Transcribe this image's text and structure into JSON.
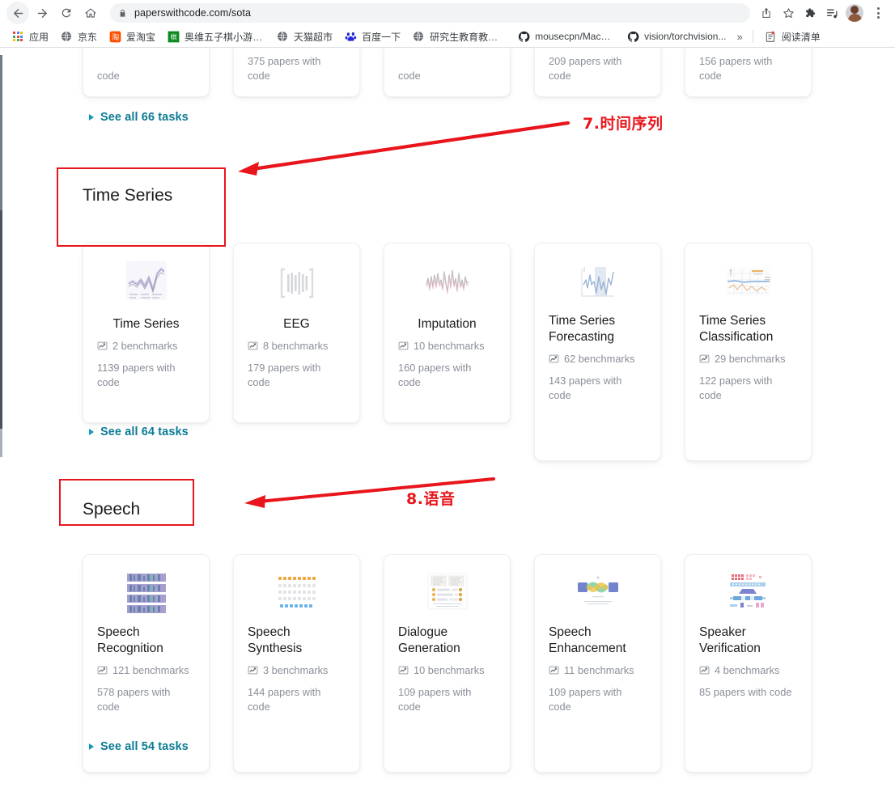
{
  "browser": {
    "url": "paperswithcode.com/sota",
    "nav": {
      "back": "back-arrow",
      "forward": "forward-arrow",
      "reload": "reload",
      "home": "home"
    },
    "toolbar_icons": [
      "share-icon",
      "star-icon",
      "extensions-icon",
      "reading-list-icon",
      "profile-avatar",
      "menu-kebab-icon"
    ],
    "bookmarks": [
      {
        "label": "应用",
        "icon": "apps-grid-icon"
      },
      {
        "label": "京东",
        "icon": "globe-icon"
      },
      {
        "label": "爱淘宝",
        "icon": "taobao-icon"
      },
      {
        "label": "奥维五子棋小游戏,...",
        "icon": "game-icon"
      },
      {
        "label": "天猫超市",
        "icon": "globe-icon"
      },
      {
        "label": "百度一下",
        "icon": "baidu-icon"
      },
      {
        "label": "研究生教育教学管...",
        "icon": "globe-icon"
      },
      {
        "label": "mousecpn/Machi...",
        "icon": "github-icon"
      },
      {
        "label": "vision/torchvision...",
        "icon": "github-icon"
      }
    ],
    "overflow_label": "»",
    "reading_list": {
      "label": "阅读清单",
      "icon": "reading-list-icon"
    }
  },
  "page": {
    "clipped_top_row": {
      "papers_labels": [
        "code",
        "375 papers with code",
        "code",
        "209 papers with code",
        "156 papers with code"
      ]
    },
    "see_all_top": "See all 66 tasks",
    "sections": [
      {
        "id": "time-series",
        "title": "Time Series",
        "see_all": "See all 64 tasks",
        "cards": [
          {
            "title": "Time Series",
            "benchmarks": "2 benchmarks",
            "papers": "1139 papers with code",
            "thumb": "line-chart-thumb",
            "center_title": true
          },
          {
            "title": "EEG",
            "benchmarks": "8 benchmarks",
            "papers": "179 papers with code",
            "thumb": "eeg-bars-thumb",
            "center_title": true
          },
          {
            "title": "Imputation",
            "benchmarks": "10 benchmarks",
            "papers": "160 papers with code",
            "thumb": "noisy-signal-thumb",
            "center_title": true
          },
          {
            "title": "Time Series Forecasting",
            "benchmarks": "62 benchmarks",
            "papers": "143 papers with code",
            "thumb": "forecast-thumb",
            "center_title": false
          },
          {
            "title": "Time Series Classification",
            "benchmarks": "29 benchmarks",
            "papers": "122 papers with code",
            "thumb": "ts-classification-thumb",
            "center_title": false
          }
        ]
      },
      {
        "id": "speech",
        "title": "Speech",
        "see_all": "See all 54 tasks",
        "cards": [
          {
            "title": "Speech Recognition",
            "benchmarks": "121 benchmarks",
            "papers": "578 papers with code",
            "thumb": "spectrogram-thumb",
            "center_title": false
          },
          {
            "title": "Speech Synthesis",
            "benchmarks": "3 benchmarks",
            "papers": "144 papers with code",
            "thumb": "dot-grid-thumb",
            "center_title": false
          },
          {
            "title": "Dialogue Generation",
            "benchmarks": "10 benchmarks",
            "papers": "109 papers with code",
            "thumb": "paper-page-thumb",
            "center_title": false
          },
          {
            "title": "Speech Enhancement",
            "benchmarks": "11 benchmarks",
            "papers": "109 papers with code",
            "thumb": "enhancement-diagram-thumb",
            "center_title": false
          },
          {
            "title": "Speaker Verification",
            "benchmarks": "4 benchmarks",
            "papers": "85 papers with code",
            "thumb": "speaker-net-thumb",
            "center_title": false
          }
        ]
      }
    ]
  },
  "annotations": [
    {
      "id": "anno-time-series",
      "text": "7.时间序列",
      "color": "#e8161c",
      "target": "Time Series"
    },
    {
      "id": "anno-speech",
      "text": "8.语音",
      "color": "#e8161c",
      "target": "Speech"
    }
  ],
  "colors": {
    "link": "#0a7b94",
    "annotation_red": "#e8161c",
    "muted_text": "#8a8f98",
    "title_text": "#1b1b1b"
  }
}
